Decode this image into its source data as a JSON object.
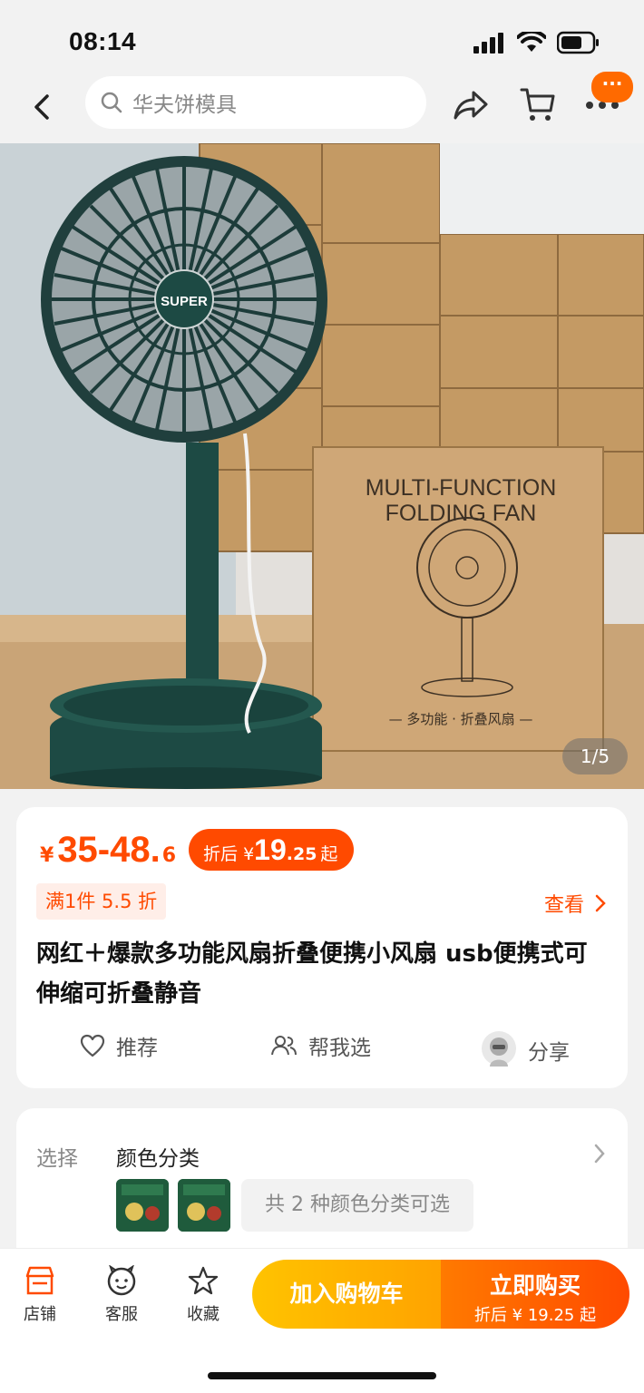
{
  "status_bar": {
    "time": "08:14"
  },
  "search": {
    "placeholder": "华夫饼模具"
  },
  "nav": {
    "message_badge": "···"
  },
  "gallery": {
    "pager": "1/5",
    "box_text_line1": "MULTI-FUNCTION",
    "box_text_line2": "FOLDING FAN",
    "box_bottom_text": "— 多功能 · 折叠风扇 —",
    "fan_logo": "SUPER"
  },
  "price": {
    "currency": "¥",
    "range_main": "35-48.",
    "range_decimal": "6",
    "after_label": "折后",
    "after_currency": "¥",
    "after_int": "19",
    "after_decimal": ".25",
    "after_suffix": "起"
  },
  "promo": {
    "label": "满1件 5.5 折",
    "view_label": "查看"
  },
  "product": {
    "title": "网红＋爆款多功能风扇折叠便携小风扇 usb便携式可伸缩可折叠静音"
  },
  "actions": {
    "recommend": "推荐",
    "help_choose": "帮我选",
    "share": "分享"
  },
  "choose": {
    "label": "选择",
    "value": "颜色分类",
    "count_text": "共 2 种颜色分类可选"
  },
  "bottom_bar": {
    "shop": "店铺",
    "service": "客服",
    "favorite": "收藏",
    "add_to_cart": "加入购物车",
    "buy_now": "立即购买",
    "buy_now_sub": "折后 ¥ 19.25 起"
  },
  "colors": {
    "accent": "#ff4a00",
    "cart_yellow": "#ffb000",
    "fan_green": "#1d4a44"
  }
}
